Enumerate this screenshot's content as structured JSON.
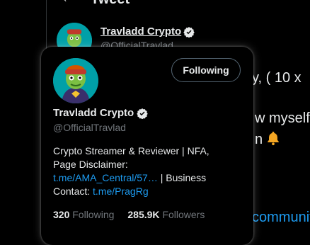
{
  "background": {
    "page_title": "Tweet",
    "author_name": "Travladd Crypto",
    "author_handle": "@OfficialTravlad",
    "text_fragment_1": "y, ( 10 x",
    "text_fragment_2": "w myself",
    "text_fragment_3": "n",
    "text_fragment_4": "communit"
  },
  "hovercard": {
    "follow_button": "Following",
    "name": "Travladd Crypto",
    "handle": "@OfficialTravlad",
    "bio_line1": "Crypto Streamer & Reviewer | NFA,",
    "bio_line2": "Page Disclaimer:",
    "bio_link1": "t.me/AMA_Central/57…",
    "bio_line3_rest": " | Business",
    "bio_line4_prefix": "Contact: ",
    "bio_link2": "t.me/PragRg",
    "following_count": "320",
    "following_label": "Following",
    "followers_count": "285.9K",
    "followers_label": "Followers"
  },
  "colors": {
    "background": "#000000",
    "primary_text": "#e7e9ea",
    "secondary_text": "#71767b",
    "link": "#1d9bf0",
    "avatar_teal": "#00a0a8",
    "bell": "#f4a623"
  },
  "icons": {
    "verified": "verified-badge-icon",
    "bell": "bell-icon",
    "back": "back-arrow-icon"
  }
}
